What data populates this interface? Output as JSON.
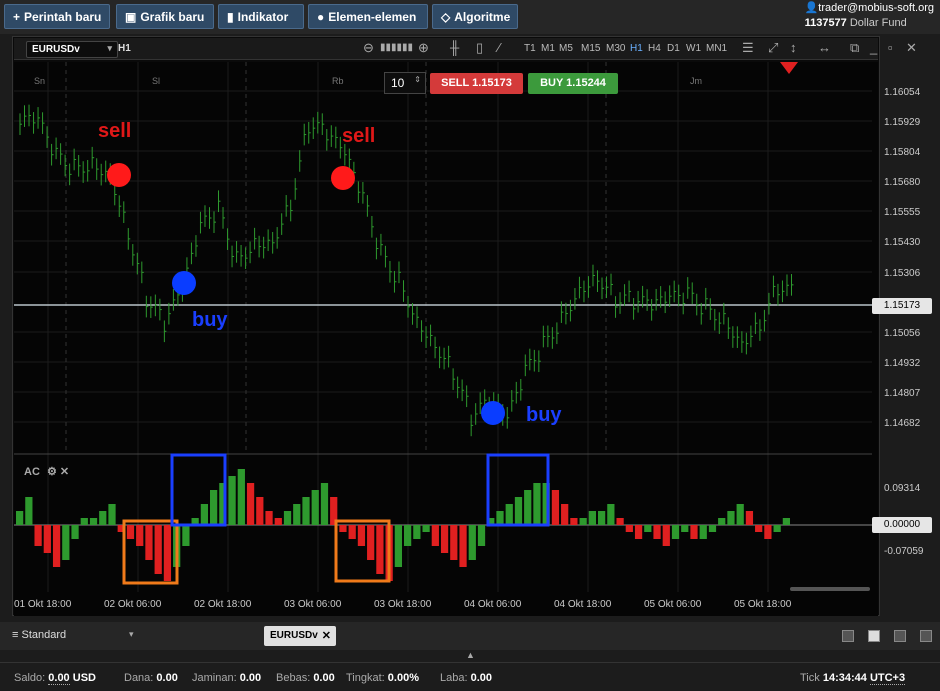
{
  "toolbar": {
    "new_order": "Perintah baru",
    "new_chart": "Grafik baru",
    "indicator": "Indikator",
    "elements": "Elemen-elemen",
    "algorithm": "Algoritme"
  },
  "account": {
    "user": "trader@mobius-soft.org",
    "number": "1137577",
    "fund": "Dollar Fund"
  },
  "chart": {
    "symbol": "EURUSDv",
    "timeframe": "H1",
    "timeframes": [
      "T1",
      "M1",
      "M5",
      "M15",
      "M30",
      "H1",
      "H4",
      "D1",
      "W1",
      "MN1"
    ],
    "active_timeframe": "H1",
    "quantity": "10",
    "sell_label": "SELL",
    "sell_price": "1.15173",
    "buy_label": "BUY",
    "buy_price": "1.15244",
    "day_labels": [
      "Sn",
      "Sl",
      "Rb",
      "Jm"
    ],
    "current_price": "1.15173",
    "price_ticks": [
      "1.16054",
      "1.15929",
      "1.15804",
      "1.15680",
      "1.15555",
      "1.15430",
      "1.15306",
      "1.15056",
      "1.14932",
      "1.14807",
      "1.14682"
    ],
    "time_labels": [
      "01 Okt 18:00",
      "02 Okt 06:00",
      "02 Okt 18:00",
      "03 Okt 06:00",
      "03 Okt 18:00",
      "04 Okt 06:00",
      "04 Okt 18:00",
      "05 Okt 06:00",
      "05 Okt 18:00"
    ],
    "annotations": {
      "sell1": "sell",
      "sell2": "sell",
      "buy1": "buy",
      "buy2": "buy"
    },
    "indicator": {
      "name": "AC",
      "ticks": [
        "0.09314",
        "-0.07059"
      ],
      "zero": "0.00000"
    },
    "colors": {
      "up": "#2e9a2e",
      "down": "#e02020",
      "sell_dot": "#ff1a1a",
      "buy_dot": "#0a3dff",
      "orange_box": "#f07a1a",
      "blue_box": "#1a3fff"
    }
  },
  "tabs": {
    "layout": "Standard",
    "active_tab": "EURUSDv"
  },
  "status": {
    "saldo_l": "Saldo:",
    "saldo": "0.00",
    "cur": "USD",
    "dana_l": "Dana:",
    "dana": "0.00",
    "jaminan_l": "Jaminan:",
    "jaminan": "0.00",
    "bebas_l": "Bebas:",
    "bebas": "0.00",
    "tingkat_l": "Tingkat:",
    "tingkat": "0.00%",
    "laba_l": "Laba:",
    "laba": "0.00",
    "tick_l": "Tick",
    "time": "14:34:44",
    "tz": "UTC+3"
  },
  "chart_data": {
    "type": "bar",
    "series_close": [
      1.1592,
      1.1578,
      1.1574,
      1.1577,
      1.1573,
      1.1548,
      1.152,
      1.1508,
      1.1522,
      1.1548,
      1.1556,
      1.1536,
      1.1544,
      1.1545,
      1.156,
      1.1592,
      1.1587,
      1.1578,
      1.156,
      1.1538,
      1.1528,
      1.1512,
      1.1502,
      1.149,
      1.147,
      1.1475,
      1.1468,
      1.1488,
      1.15,
      1.1512,
      1.1525,
      1.153,
      1.152,
      1.1518,
      1.1515,
      1.1518,
      1.152,
      1.1516,
      1.1512,
      1.1503,
      1.151,
      1.1525,
      1.152
    ]
  }
}
